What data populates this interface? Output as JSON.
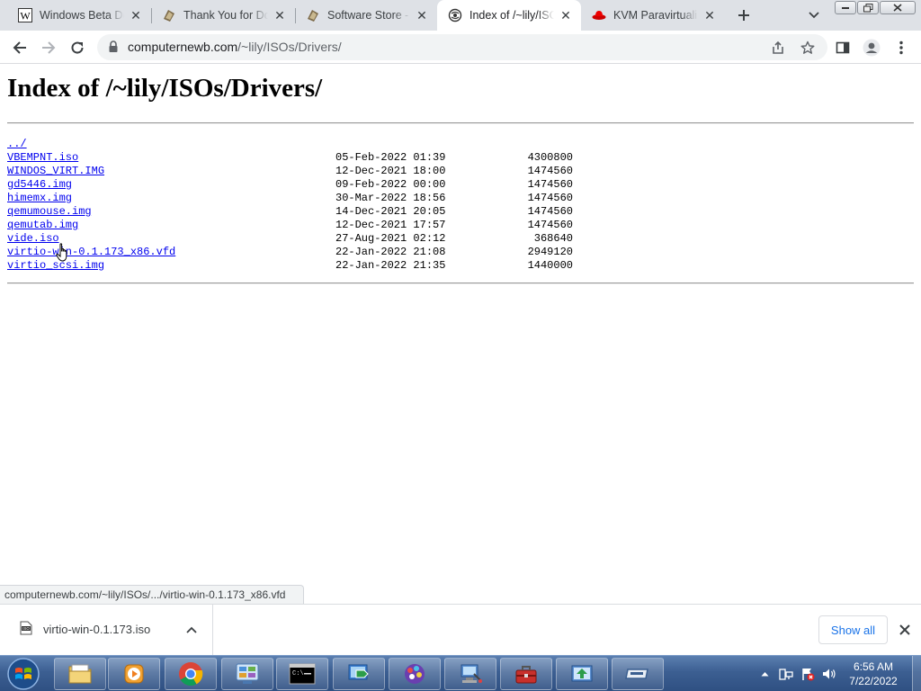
{
  "browser": {
    "tabs": [
      {
        "title": "Windows Beta De",
        "icon": "wikipedia-icon",
        "active": false
      },
      {
        "title": "Thank You for Do",
        "icon": "winworld-icon",
        "active": false
      },
      {
        "title": "Software Store - N",
        "icon": "winworld-icon",
        "active": false
      },
      {
        "title": "Index of /~lily/ISO",
        "icon": "web-icon",
        "active": true
      },
      {
        "title": "KVM Paravirtualiz",
        "icon": "redhat-icon",
        "active": false
      }
    ],
    "url": {
      "host": "computernewb.com",
      "path": "/~lily/ISOs/Drivers/"
    }
  },
  "page": {
    "title": "Index of /~lily/ISOs/Drivers/",
    "parent_link": "../",
    "files": [
      {
        "name": "VBEMPNT.iso",
        "date": "05-Feb-2022 01:39",
        "size": "4300800"
      },
      {
        "name": "WINDOS_VIRT.IMG",
        "date": "12-Dec-2021 18:00",
        "size": "1474560"
      },
      {
        "name": "gd5446.img",
        "date": "09-Feb-2022 00:00",
        "size": "1474560"
      },
      {
        "name": "himemx.img",
        "date": "30-Mar-2022 18:56",
        "size": "1474560"
      },
      {
        "name": "qemumouse.img",
        "date": "14-Dec-2021 20:05",
        "size": "1474560"
      },
      {
        "name": "qemutab.img",
        "date": "12-Dec-2021 17:57",
        "size": "1474560"
      },
      {
        "name": "vide.iso",
        "date": "27-Aug-2021 02:12",
        "size": "368640"
      },
      {
        "name": "virtio-win-0.1.173_x86.vfd",
        "date": "22-Jan-2022 21:08",
        "size": "2949120"
      },
      {
        "name": "virtio_scsi.img",
        "date": "22-Jan-2022 21:35",
        "size": "1440000"
      }
    ]
  },
  "status_bar": {
    "text": "computernewb.com/~lily/ISOs/.../virtio-win-0.1.173_x86.vfd"
  },
  "downloads": {
    "item_name": "virtio-win-0.1.173.iso",
    "show_all_label": "Show all"
  },
  "taskbar": {
    "time": "6:56 AM",
    "date": "7/22/2022"
  },
  "colors": {
    "link": "#0000ee",
    "tabstrip": "#dee1e6",
    "accent": "#1a73e8",
    "taskbar": "#3c5f92"
  }
}
